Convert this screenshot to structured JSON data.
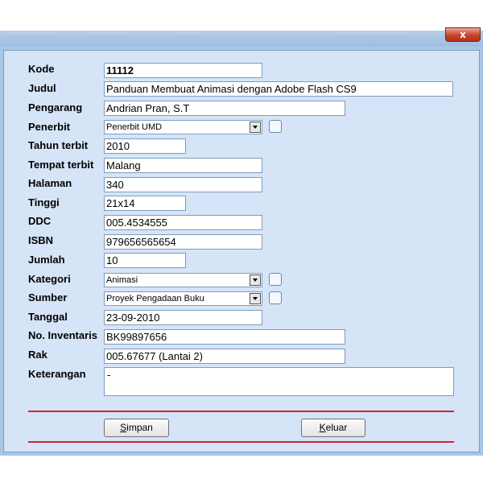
{
  "window": {
    "close_label": "x"
  },
  "form": {
    "kode": {
      "label": "Kode",
      "value": "11112"
    },
    "judul": {
      "label": "Judul",
      "value": "Panduan Membuat Animasi dengan Adobe Flash CS9"
    },
    "pengarang": {
      "label": "Pengarang",
      "value": "Andrian Pran, S.T"
    },
    "penerbit": {
      "label": "Penerbit",
      "value": "Penerbit UMD"
    },
    "tahun": {
      "label": "Tahun terbit",
      "value": "2010"
    },
    "tempat": {
      "label": "Tempat terbit",
      "value": "Malang"
    },
    "halaman": {
      "label": "Halaman",
      "value": "340"
    },
    "tinggi": {
      "label": "Tinggi",
      "value": "21x14"
    },
    "ddc": {
      "label": "DDC",
      "value": "005.4534555"
    },
    "isbn": {
      "label": "ISBN",
      "value": "979656565654"
    },
    "jumlah": {
      "label": "Jumlah",
      "value": "10"
    },
    "kategori": {
      "label": "Kategori",
      "value": "Animasi"
    },
    "sumber": {
      "label": "Sumber",
      "value": "Proyek Pengadaan Buku"
    },
    "tanggal": {
      "label": "Tanggal",
      "value": "23-09-2010"
    },
    "inventaris": {
      "label": "No. Inventaris",
      "value": "BK99897656"
    },
    "rak": {
      "label": "Rak",
      "value": "005.67677 (Lantai 2)"
    },
    "keterangan": {
      "label": "Keterangan",
      "value": "-"
    }
  },
  "buttons": {
    "simpan_hotkey": "S",
    "simpan_rest": "impan",
    "keluar_hotkey": "K",
    "keluar_rest": "eluar"
  },
  "colors": {
    "panel": "#d5e4f7",
    "frame": "#a8c7e8",
    "separator": "#d5202a",
    "close": "#c7422a"
  }
}
